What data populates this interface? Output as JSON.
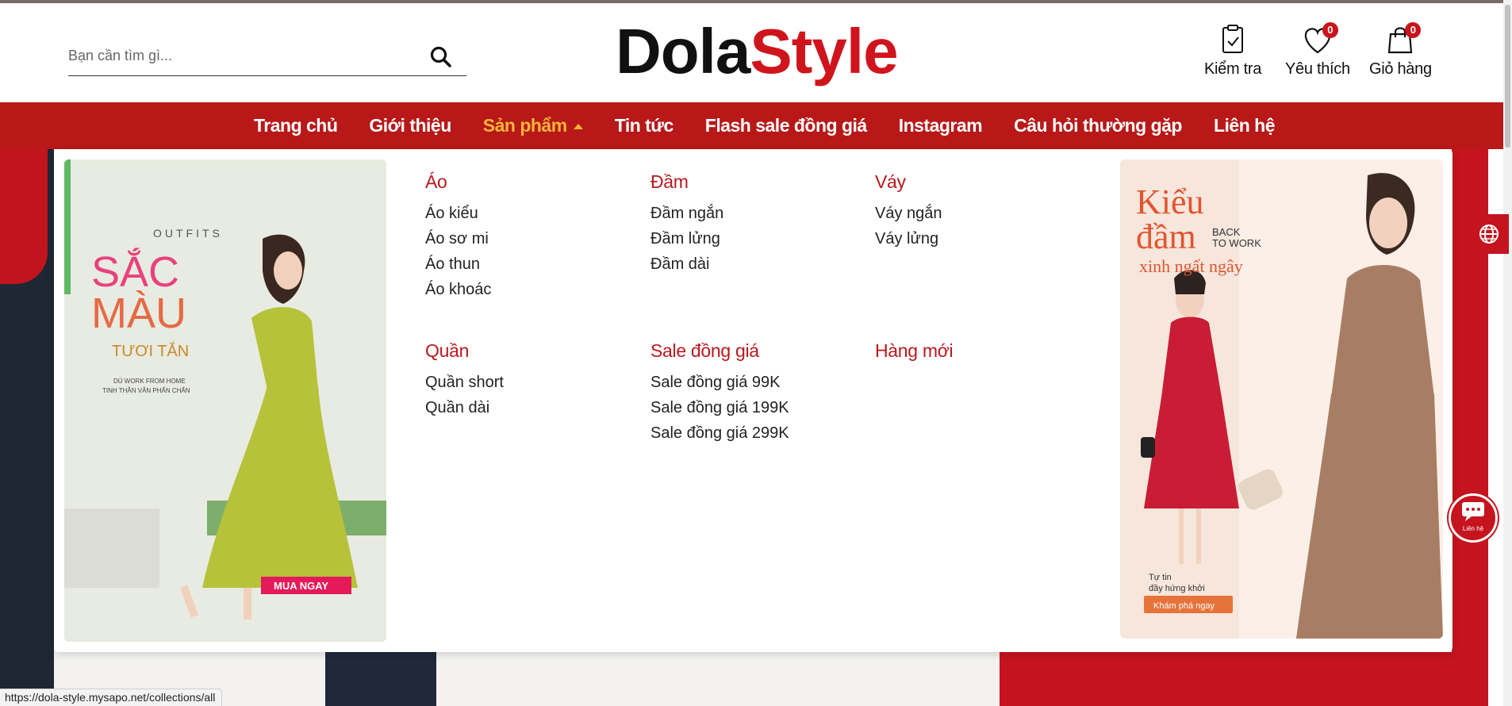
{
  "header": {
    "search_placeholder": "Bạn cần tìm gì...",
    "logo_part1": "Dola",
    "logo_part2": "Style",
    "check_label": "Kiểm tra",
    "wishlist_label": "Yêu thích",
    "wishlist_count": "0",
    "cart_label": "Giỏ hàng",
    "cart_count": "0"
  },
  "nav": {
    "items": [
      "Trang chủ",
      "Giới thiệu",
      "Sản phẩm",
      "Tin tức",
      "Flash sale đồng giá",
      "Instagram",
      "Câu hỏi thường gặp",
      "Liên hệ"
    ],
    "active_index": 2
  },
  "mega_menu": {
    "categories": [
      {
        "title": "Áo",
        "items": [
          "Áo kiểu",
          "Áo sơ mi",
          "Áo thun",
          "Áo khoác"
        ]
      },
      {
        "title": "Đầm",
        "items": [
          "Đầm ngắn",
          "Đầm lửng",
          "Đầm dài"
        ]
      },
      {
        "title": "Váy",
        "items": [
          "Váy ngắn",
          "Váy lửng"
        ]
      },
      {
        "title": "Quần",
        "items": [
          "Quần short",
          "Quần dài"
        ]
      },
      {
        "title": "Sale đồng giá",
        "items": [
          "Sale đồng giá 99K",
          "Sale đồng giá 199K",
          "Sale đồng giá 299K"
        ]
      },
      {
        "title": "Hàng mới",
        "items": []
      }
    ],
    "promo_left": {
      "line1": "OUTFITS",
      "line2": "SẮC",
      "line3": "MÀU",
      "line4": "TƯƠI TẮN",
      "line5": "DÙ WORK FROM HOME",
      "line6": "TINH THẦN VẪN PHẤN CHẤN",
      "cta": "MUA NGAY"
    },
    "promo_right": {
      "line1": "Kiểu",
      "line2": "đầm",
      "line3a": "BACK",
      "line3b": "TO WORK",
      "line4": "xinh ngất ngây",
      "line5": "Tự tin",
      "line6": "đầy hứng khởi",
      "cta": "Khám phá ngay"
    }
  },
  "floating": {
    "chat_label": "Liên hệ"
  },
  "status_bar": {
    "url": "https://dola-style.mysapo.net/collections/all"
  },
  "colors": {
    "brand_red": "#b81818",
    "accent_gold": "#f2b53a",
    "category_red": "#b8191e"
  }
}
